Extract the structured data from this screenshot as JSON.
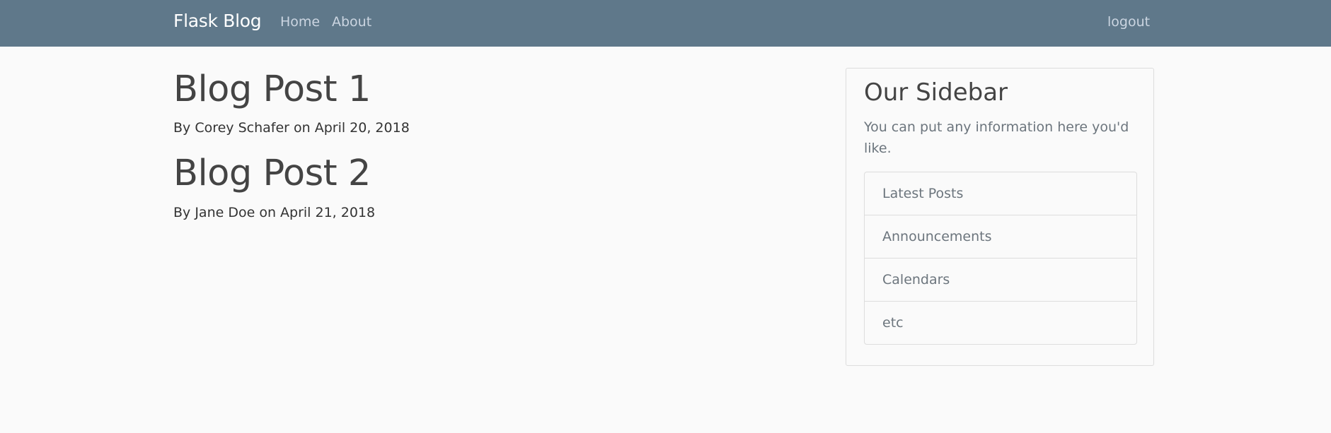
{
  "navbar": {
    "brand": "Flask Blog",
    "links": [
      {
        "label": "Home"
      },
      {
        "label": "About"
      }
    ],
    "logout_label": "logout"
  },
  "posts": [
    {
      "title": "Blog Post 1",
      "meta": "By Corey Schafer on April 20, 2018"
    },
    {
      "title": "Blog Post 2",
      "meta": "By Jane Doe on April 21, 2018"
    }
  ],
  "sidebar": {
    "title": "Our Sidebar",
    "text": "You can put any information here you'd like.",
    "items": [
      {
        "label": "Latest Posts"
      },
      {
        "label": "Announcements"
      },
      {
        "label": "Calendars"
      },
      {
        "label": "etc"
      }
    ]
  },
  "colors": {
    "navbar_bg": "#5f788a",
    "page_bg": "#fafafa",
    "brand_text": "#ffffff",
    "nav_link": "#cbd5e1",
    "muted_text": "#6c757d"
  }
}
